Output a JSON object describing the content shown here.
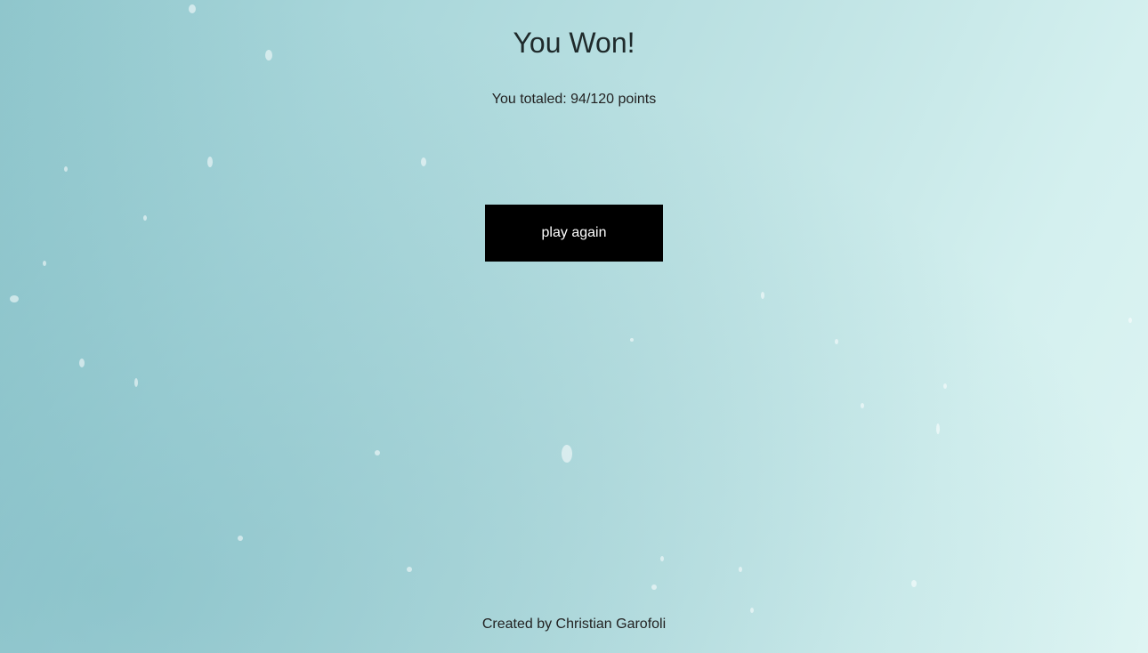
{
  "game_over": {
    "title": "You Won!",
    "score_text": "You totaled: 94/120 points",
    "play_again_label": "play again"
  },
  "footer": {
    "credit": "Created by Christian Garofoli"
  },
  "colors": {
    "background": "#bfe3e4",
    "button_bg": "#000000",
    "button_text": "#ffffff",
    "text": "#222222"
  }
}
